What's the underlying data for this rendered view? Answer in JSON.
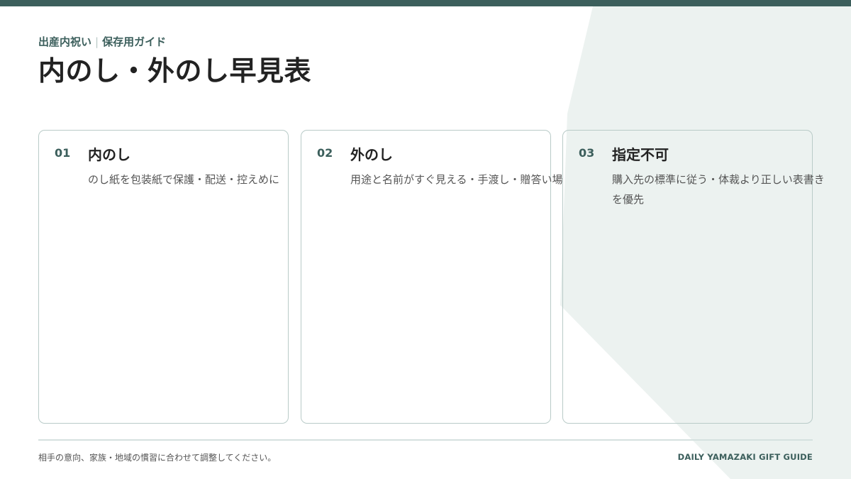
{
  "colors": {
    "accent": "#3c5f5c",
    "card_border": "#b9cbc8",
    "bg_shape": "#ecf2f0",
    "title": "#222222",
    "text": "#555555"
  },
  "header": {
    "category": "出産内祝い",
    "separator": "|",
    "guide_label": "保存用ガイド",
    "title": "内のし・外のし早見表"
  },
  "cards": [
    {
      "number": "01",
      "title": "内のし",
      "description": "のし紙を包装紙で保護・配送・控えめに"
    },
    {
      "number": "02",
      "title": "外のし",
      "description": "用途と名前がすぐ見える・手渡し・贈答い場"
    },
    {
      "number": "03",
      "title": "指定不可",
      "description": "購入先の標準に従う・体裁より正しい表書きを優先"
    }
  ],
  "footer": {
    "note": "相手の意向、家族・地域の慣習に合わせて調整してください。",
    "brand": "DAILY YAMAZAKI GIFT GUIDE"
  }
}
